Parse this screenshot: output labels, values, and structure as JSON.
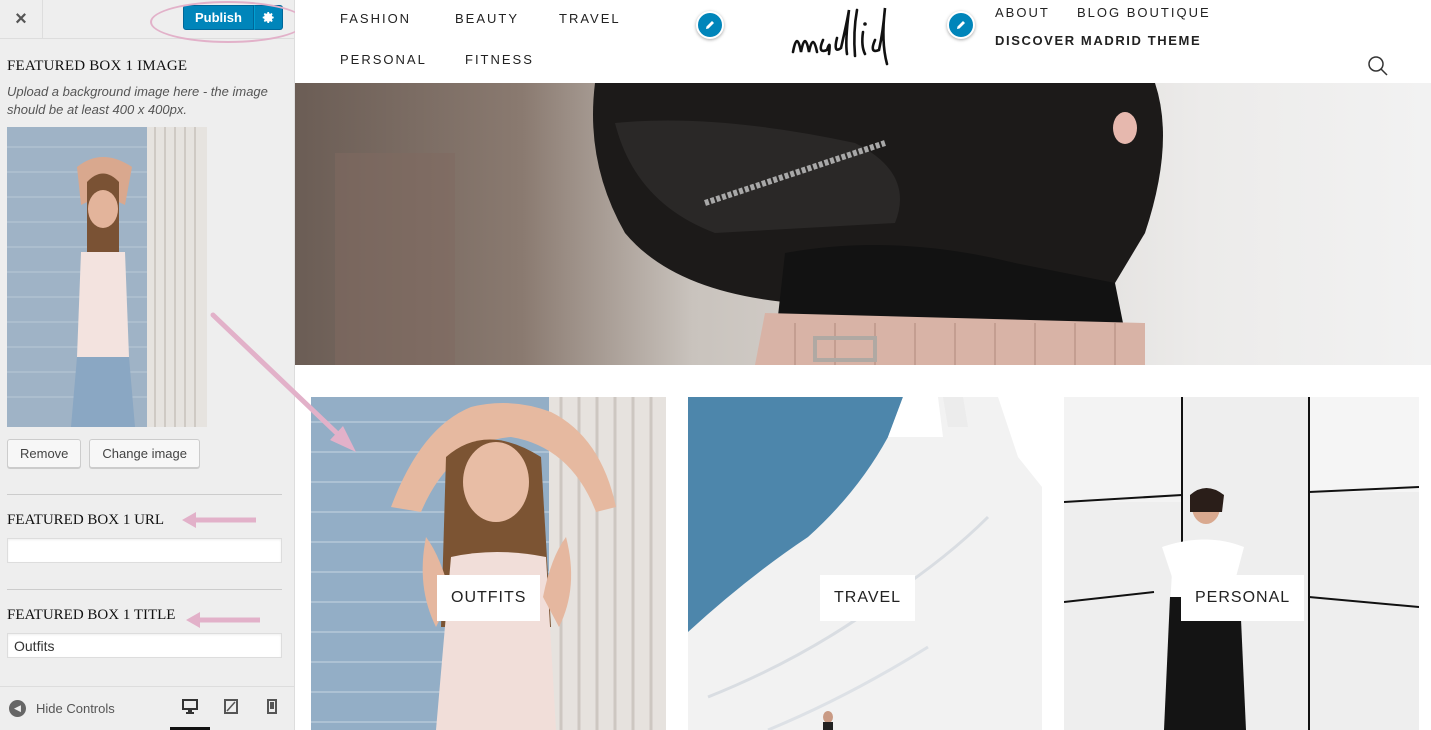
{
  "customizer": {
    "close_label": "×",
    "publish_label": "Publish",
    "settings_icon": "gear-icon",
    "section": {
      "image_title": "FEATURED BOX 1 IMAGE",
      "image_description": "Upload a background image here - the image should be at least 400 x 400px.",
      "remove_label": "Remove",
      "change_label": "Change image",
      "url_title": "FEATURED BOX 1 URL",
      "url_value": "",
      "title_title": "FEATURED BOX 1 TITLE",
      "title_value": "Outfits"
    },
    "footer": {
      "hide_label": "Hide Controls",
      "devices": [
        "desktop",
        "tablet",
        "mobile"
      ],
      "active_device": "desktop"
    },
    "colors": {
      "accent": "#0085ba",
      "annotation": "#e2b1c9"
    }
  },
  "site": {
    "nav_left": [
      "FASHION",
      "BEAUTY",
      "TRAVEL",
      "PERSONAL",
      "FITNESS"
    ],
    "logo": "madrid",
    "nav_right": [
      "ABOUT",
      "BLOG BOUTIQUE"
    ],
    "nav_right_bold": "DISCOVER MADRID THEME",
    "featured_boxes": [
      {
        "label": "OUTFITS"
      },
      {
        "label": "TRAVEL"
      },
      {
        "label": "PERSONAL"
      }
    ]
  }
}
